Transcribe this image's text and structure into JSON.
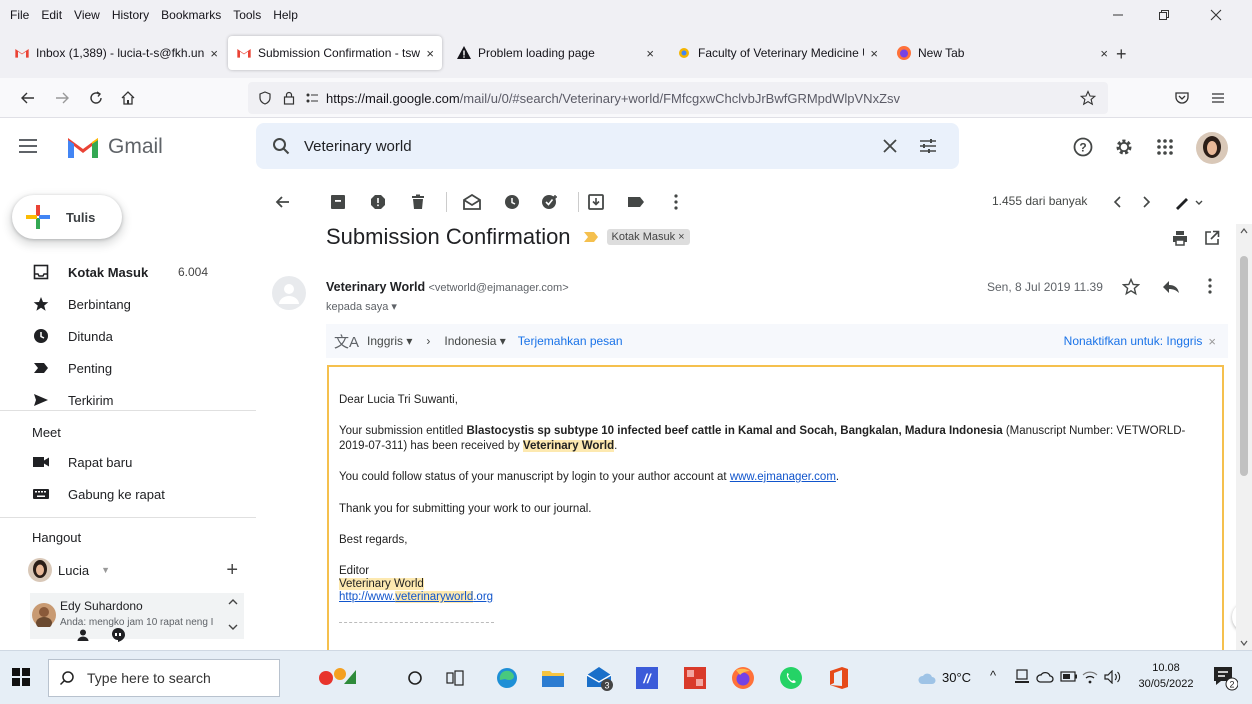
{
  "menubar": {
    "items": [
      "File",
      "Edit",
      "View",
      "History",
      "Bookmarks",
      "Tools",
      "Help"
    ]
  },
  "tabs": [
    {
      "label": "Inbox (1,389) - lucia-t-s@fkh.un",
      "icon": "gmail-icon"
    },
    {
      "label": "Submission Confirmation - tswa",
      "icon": "gmail-icon"
    },
    {
      "label": "Problem loading page",
      "icon": "warning-icon"
    },
    {
      "label": "Faculty of Veterinary Medicine U",
      "icon": "site-icon"
    },
    {
      "label": "New Tab",
      "icon": "firefox-icon"
    }
  ],
  "urlbar": {
    "url_domain": "https://mail.google.com",
    "url_path": "/mail/u/0/#search/Veterinary+world/FMfcgxwChclvbJrBwfGRMpdWlpVNxZsv"
  },
  "gmail": {
    "logo_text": "Gmail",
    "search_value": "Veterinary world"
  },
  "sidebar": {
    "compose_label": "Tulis",
    "items": [
      {
        "label": "Kotak Masuk",
        "count": "6.004",
        "icon": "inbox-icon"
      },
      {
        "label": "Berbintang",
        "icon": "star-icon"
      },
      {
        "label": "Ditunda",
        "icon": "clock-icon"
      },
      {
        "label": "Penting",
        "icon": "important-icon"
      },
      {
        "label": "Terkirim",
        "icon": "send-icon"
      }
    ],
    "meet_title": "Meet",
    "meet_items": [
      {
        "label": "Rapat baru",
        "icon": "video-icon"
      },
      {
        "label": "Gabung ke rapat",
        "icon": "keyboard-icon"
      }
    ],
    "hangout_title": "Hangout",
    "hangout_user": "Lucia",
    "contact_name": "Edy Suhardono",
    "contact_msg": "Anda: mengko jam 10 rapat neng I"
  },
  "toolbar": {
    "pagination": "1.455 dari banyak"
  },
  "message": {
    "subject": "Submission Confirmation",
    "label_chip": "Kotak Masuk ×",
    "sender_name": "Veterinary World",
    "sender_email": "<vetworld@ejmanager.com>",
    "to_line": "kepada saya ▾",
    "date": "Sen, 8 Jul 2019 11.39",
    "translate": {
      "from_lang": "Inggris ▾",
      "to_lang": "Indonesia ▾",
      "translate_link": "Terjemahkan pesan",
      "disable_link": "Nonaktifkan untuk: Inggris"
    },
    "body": {
      "greeting": "Dear Lucia Tri Suwanti,",
      "p1_a": "Your submission entitled ",
      "p1_title": "Blastocystis sp subtype 10 infected beef cattle in Kamal and Socah, Bangkalan, Madura Indonesia",
      "p1_b": " (Manuscript Number: VETWORLD-2019-07-311) has been received by ",
      "p1_journal": "Veterinary World",
      "p1_end": ".",
      "p2_a": "You could follow status of your manuscript by login to your author account at ",
      "p2_link": "www.ejmanager.com",
      "p2_end": ".",
      "p3": "Thank you for submitting your work to our journal.",
      "p4": "Best regards,",
      "sig_role": "Editor",
      "sig_journal": "Veterinary World",
      "sig_link_a": "http://www.",
      "sig_link_b": "veterinaryworld",
      "sig_link_c": ".org"
    }
  },
  "taskbar": {
    "search_placeholder": "Type here to search",
    "weather": "30°C",
    "time": "10.08",
    "date": "30/05/2022",
    "notif_count": "2",
    "badge_count": "3"
  }
}
